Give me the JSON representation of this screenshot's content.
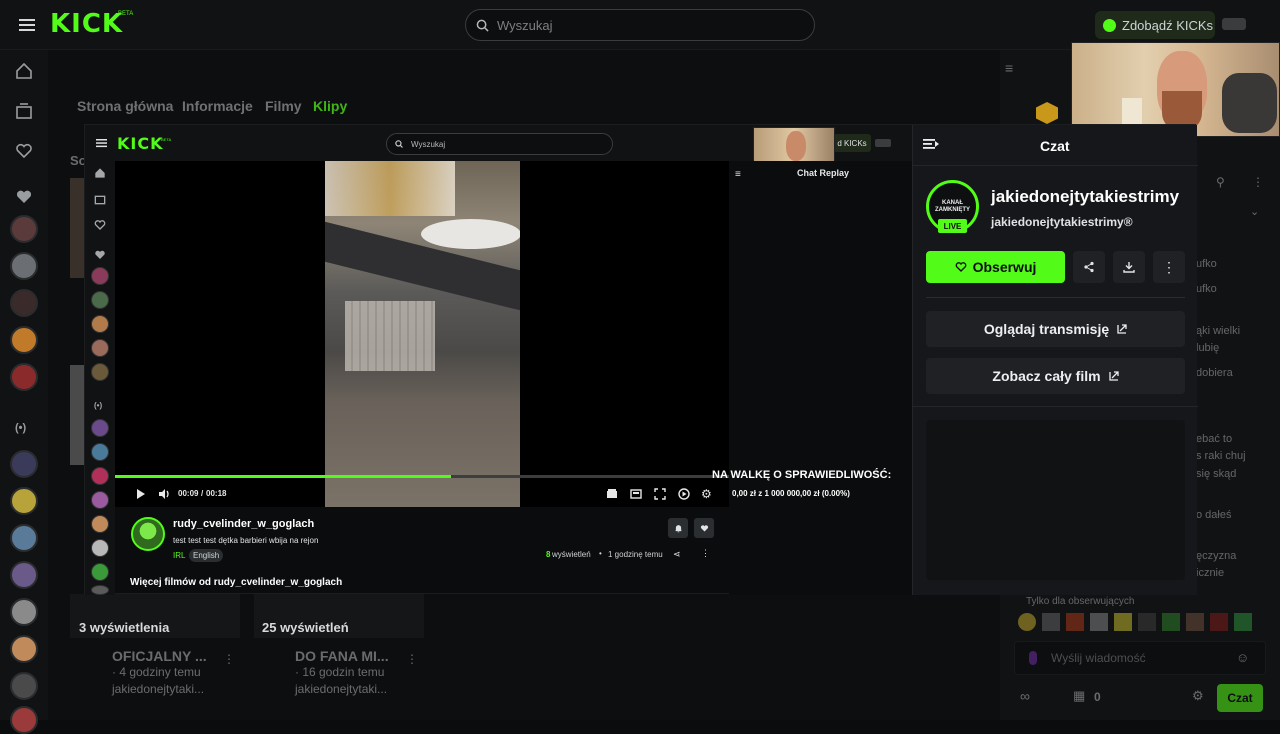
{
  "app": {
    "logo_text": "KICK",
    "logo_beta": "BETA"
  },
  "topbar": {
    "search_placeholder": "Wyszukaj",
    "kicks_button": "Zdobądź KICKs"
  },
  "background_page": {
    "tabs": [
      "Strona główna",
      "Informacje",
      "Filmy",
      "Klipy"
    ],
    "active_tab": "Klipy",
    "cards": [
      {
        "views": "3 wyświetlenia",
        "title": "OFICJALNY ...",
        "time": "· 4 godziny temu",
        "channel": "jakiedonejtytaki..."
      },
      {
        "views": "25 wyświetleń",
        "title": "DO FANA MI...",
        "time": "· 16 godzin temu",
        "channel": "jakiedonejtytaki..."
      }
    ],
    "partial_label": "So"
  },
  "bg_chat": {
    "lines": [
      "ufko",
      "ufko",
      "ąki wielki",
      "lubię",
      "dobiera",
      "ebać to",
      "s raki chuj",
      "się skąd",
      "o dałeś",
      "ęczyzna",
      "icznie"
    ],
    "followers_only": "Tylko dla obserwujących",
    "message_placeholder": "Wyślij wiadomość",
    "kicks_count": "0",
    "chat_button": "Czat"
  },
  "inner": {
    "search_placeholder": "Wyszukaj",
    "kicks_short": "d KICKs",
    "chat_replay_label": "Chat Replay"
  },
  "video": {
    "current_time": "00:09",
    "separator": "/",
    "duration": "00:18",
    "progress": 0.548,
    "overlay_title": "NA WALKĘ O SPRAWIEDLIWOŚĆ:",
    "overlay_amount": "0,00 zł z 1 000 000,00 zł (0.00%)"
  },
  "clip": {
    "author": "rudy_cvelinder_w_goglach",
    "title": "test test test dętka barbieri wbija na rejon",
    "category": "IRL",
    "language": "English",
    "views_count": "8",
    "views_label": "wyświetleń",
    "time_ago": "1 godzinę temu",
    "more_from": "Więcej filmów od rudy_cvelinder_w_goglach"
  },
  "panel": {
    "header_title": "Czat",
    "channel_name": "jakiedonejtytakiestrimy",
    "channel_handle": "jakiedonejtytakiestrimy®",
    "avatar_text": "KANAŁ ZAMKNIĘTY",
    "live_badge": "LIVE",
    "follow_button": "Obserwuj",
    "watch_stream": "Oglądaj transmisję",
    "see_full_video": "Zobacz cały film"
  },
  "colors": {
    "brand_green": "#53fc18",
    "panel_bg": "#16171a",
    "button_bg": "#1f2124"
  }
}
